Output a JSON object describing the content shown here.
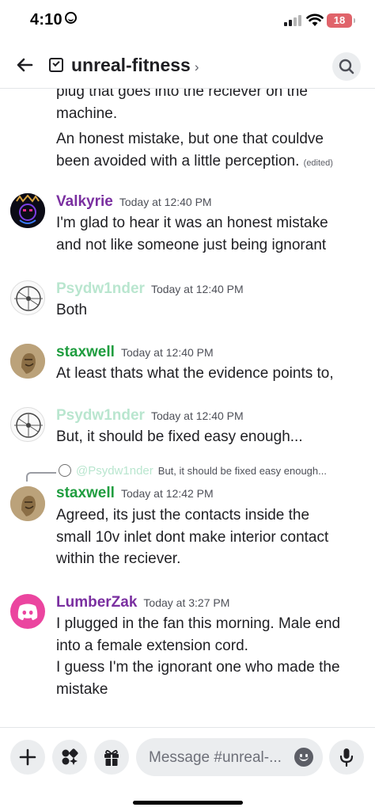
{
  "status_bar": {
    "time": "4:10",
    "battery": "18"
  },
  "header": {
    "channel_name": "unreal-fitness",
    "chevron": "›"
  },
  "messages": [
    {
      "lines": [
        "plug that goes into the reciever on the",
        "machine.",
        "An honest mistake, but one that couldve",
        "been avoided with a little perception."
      ],
      "edited": "(edited)"
    },
    {
      "author": "Valkyrie",
      "author_color": "#7a2fa0",
      "timestamp": "Today at 12:40 PM",
      "lines": [
        "I'm glad to hear it was an honest mistake",
        "and not like someone just being ignorant"
      ]
    },
    {
      "author": "Psydw1nder",
      "author_color": "#b9e6cf",
      "timestamp": "Today at 12:40 PM",
      "lines": [
        "Both"
      ]
    },
    {
      "author": "staxwell",
      "author_color": "#1f9d3f",
      "timestamp": "Today at 12:40 PM",
      "lines": [
        "At least thats what the evidence points to,"
      ]
    },
    {
      "author": "Psydw1nder",
      "author_color": "#b9e6cf",
      "timestamp": "Today at 12:40 PM",
      "lines": [
        "But, it should be fixed easy enough..."
      ]
    },
    {
      "reply": {
        "name": "@Psydw1nder",
        "text": "But, it should be fixed easy enough..."
      },
      "author": "staxwell",
      "author_color": "#1f9d3f",
      "timestamp": "Today at 12:42 PM",
      "lines": [
        "Agreed, its just the contacts inside the",
        "small 10v inlet dont make interior contact",
        "within the reciever."
      ]
    },
    {
      "author": "LumberZak",
      "author_color": "#7a2fa0",
      "timestamp": "Today at 3:27 PM",
      "lines": [
        "I plugged in the fan this morning. Male end",
        "into a female extension cord.",
        "I guess I'm the ignorant one who made the",
        "mistake"
      ]
    }
  ],
  "composer": {
    "placeholder": "Message #unreal-..."
  },
  "icons": {
    "back": "arrow-left-icon",
    "channel": "forum-channel-icon",
    "search": "search-icon",
    "add": "plus-icon",
    "apps": "apps-icon",
    "gift": "gift-icon",
    "emoji": "emoji-icon",
    "mic": "microphone-icon"
  }
}
